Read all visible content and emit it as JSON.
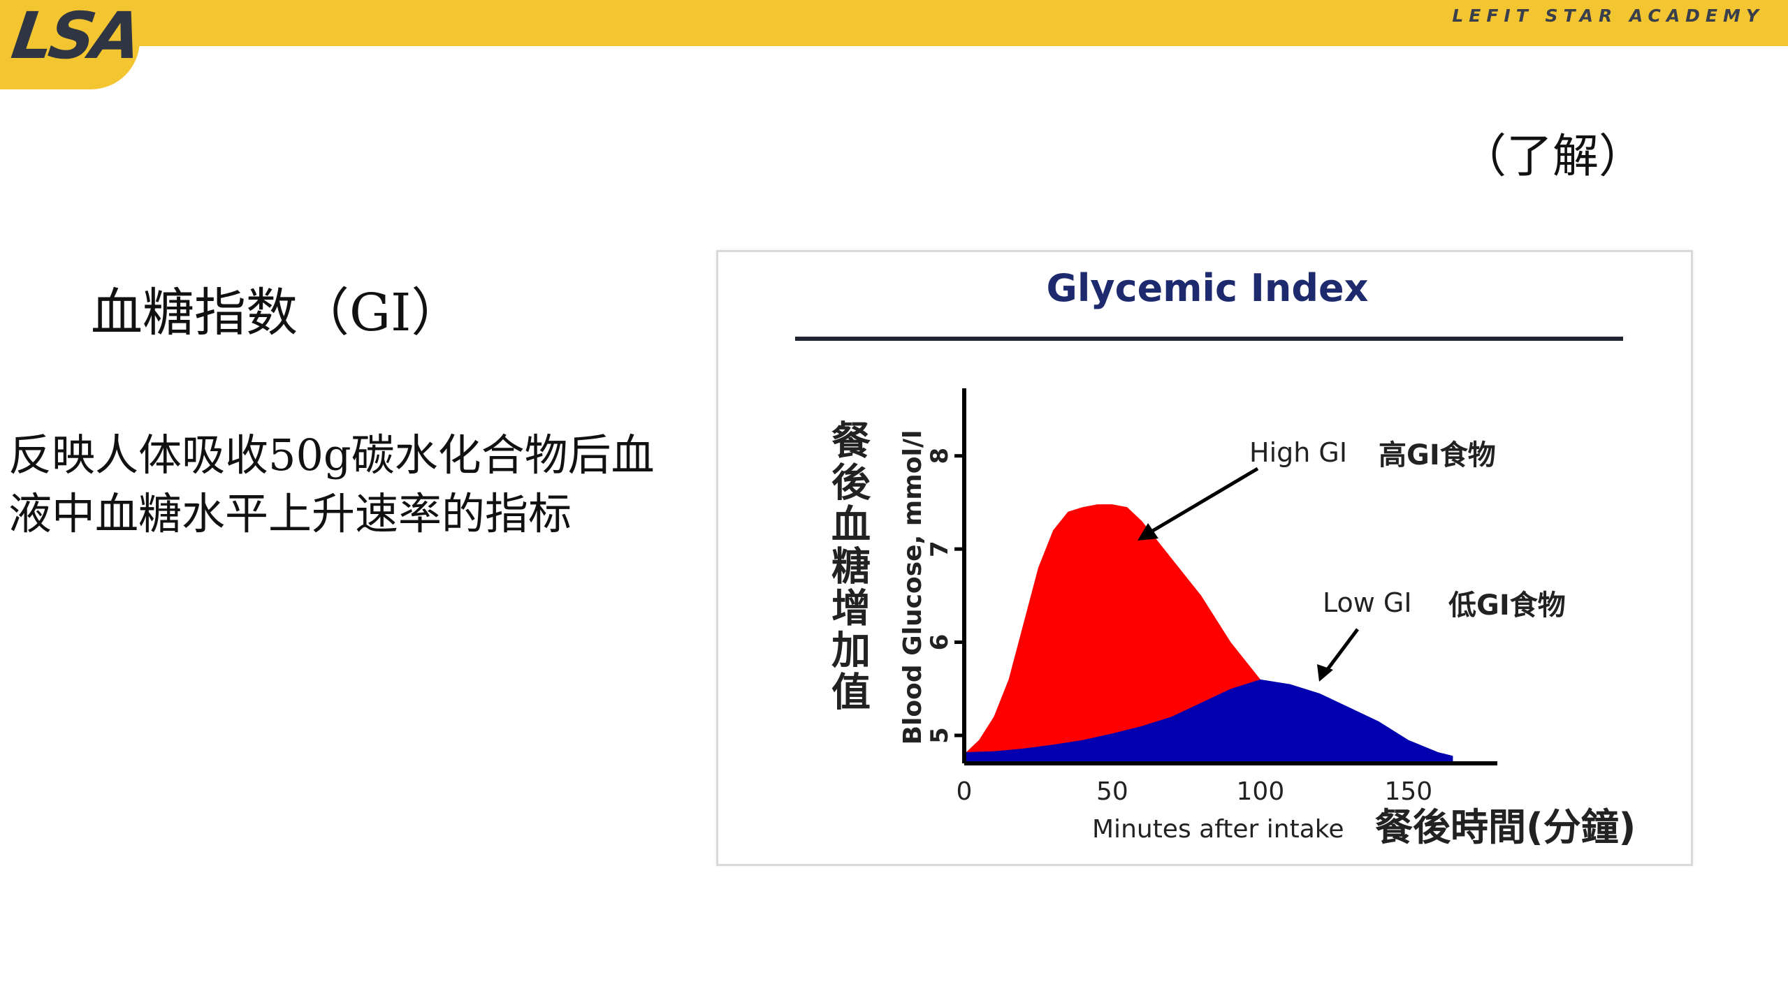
{
  "header": {
    "logo": "LSA",
    "academy": "LEFIT STAR ACADEMY"
  },
  "hint": "（了解）",
  "title": "血糖指数（GI）",
  "description": {
    "line1": "反映人体吸收50g碳水化合物后血",
    "line2": "液中血糖水平上升速率的指标"
  },
  "chart_data": {
    "type": "area",
    "title": "Glycemic Index",
    "ylabel": "Blood Glucose, mmol/l",
    "ylabel_zh": "餐後血糖增加值",
    "xlabel": "Minutes after intake",
    "xlabel_zh": "餐後時間(分鐘)",
    "xlim": [
      0,
      180
    ],
    "ylim": [
      4.7,
      8.5
    ],
    "x_ticks": [
      0,
      50,
      100,
      150
    ],
    "y_ticks": [
      5,
      6,
      7,
      8
    ],
    "grid": false,
    "series": [
      {
        "name": "High GI",
        "color": "#ff0000",
        "x": [
          0,
          5,
          10,
          15,
          20,
          25,
          30,
          35,
          40,
          45,
          50,
          55,
          60,
          70,
          80,
          90,
          100,
          110,
          120
        ],
        "y": [
          4.8,
          4.95,
          5.2,
          5.6,
          6.2,
          6.8,
          7.2,
          7.4,
          7.45,
          7.48,
          7.48,
          7.45,
          7.3,
          6.9,
          6.5,
          6.0,
          5.6,
          5.45,
          5.35
        ]
      },
      {
        "name": "Low GI",
        "color": "#0000b0",
        "x": [
          0,
          10,
          20,
          30,
          40,
          50,
          60,
          70,
          80,
          90,
          100,
          110,
          120,
          130,
          140,
          150,
          160,
          165
        ],
        "y": [
          4.82,
          4.83,
          4.86,
          4.9,
          4.95,
          5.02,
          5.1,
          5.2,
          5.35,
          5.5,
          5.6,
          5.55,
          5.45,
          5.3,
          5.15,
          4.95,
          4.82,
          4.78
        ]
      }
    ],
    "annotations": [
      {
        "series": "High GI",
        "text": "High GI",
        "text_zh": "高GI食物"
      },
      {
        "series": "Low GI",
        "text": "Low GI",
        "text_zh": "低GI食物"
      }
    ]
  }
}
